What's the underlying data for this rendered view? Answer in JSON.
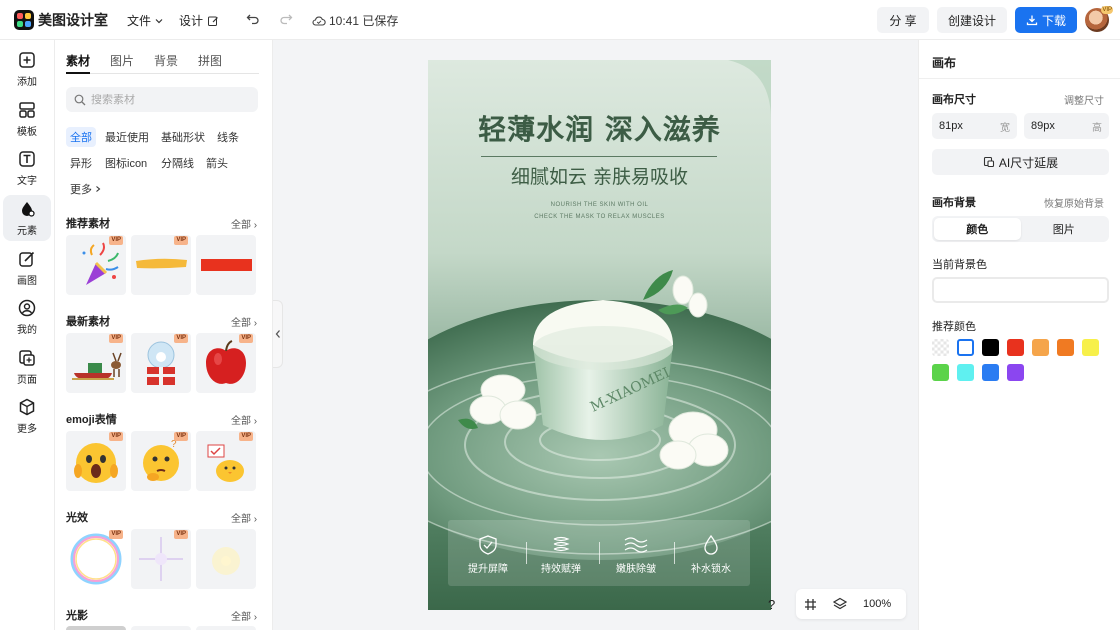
{
  "app": {
    "name": "美图设计室"
  },
  "topbar": {
    "file_menu": "文件",
    "design_menu": "设计",
    "save_status": "10:41 已保存",
    "share": "分 享",
    "create_design": "创建设计",
    "download": "下载",
    "avatar_badge": "VIP"
  },
  "rail": {
    "items": [
      {
        "label": "添加",
        "icon": "plus-square-icon"
      },
      {
        "label": "模板",
        "icon": "layout-icon"
      },
      {
        "label": "文字",
        "icon": "text-icon"
      },
      {
        "label": "元素",
        "icon": "shapes-icon"
      },
      {
        "label": "画图",
        "icon": "pen-icon"
      },
      {
        "label": "我的",
        "icon": "user-icon"
      },
      {
        "label": "页面",
        "icon": "page-add-icon"
      },
      {
        "label": "更多",
        "icon": "cube-icon"
      }
    ]
  },
  "panel": {
    "tabs": [
      "素材",
      "图片",
      "背景",
      "拼图"
    ],
    "search_placeholder": "搜索素材",
    "chips": [
      "全部",
      "最近使用",
      "基础形状",
      "线条",
      "异形",
      "图标icon",
      "分隔线",
      "箭头",
      "更多"
    ],
    "sections": [
      {
        "title": "推荐素材",
        "all": "全部"
      },
      {
        "title": "最新素材",
        "all": "全部"
      },
      {
        "title": "emoji表情",
        "all": "全部"
      },
      {
        "title": "光效",
        "all": "全部"
      },
      {
        "title": "光影",
        "all": "全部"
      }
    ],
    "vip_badge": "VIP"
  },
  "poster": {
    "headline": "轻薄水润 深入滋养",
    "subheadline": "细腻如云 亲肤易吸收",
    "english_line1": "NOURISH THE SKIN WITH OIL",
    "english_line2": "CHECK THE MASK TO RELAX MUSCLES",
    "jar_brand": "M-XIAOMEI",
    "features": [
      "提升屏障",
      "持效赋弹",
      "嫩肤除皱",
      "补水锁水"
    ]
  },
  "canvas_tools": {
    "help": "?",
    "zoom": "100%"
  },
  "right_panel": {
    "title": "画布",
    "size_label": "画布尺寸",
    "adjust_size": "调整尺寸",
    "width_value": "81px",
    "width_unit": "宽",
    "height_value": "89px",
    "height_unit": "高",
    "ai_extend": "AI尺寸延展",
    "bg_label": "画布背景",
    "restore_bg": "恢复原始背景",
    "seg_color": "颜色",
    "seg_image": "图片",
    "current_bg": "当前背景色",
    "recommended": "推荐颜色",
    "swatches": [
      "transparent",
      "#ffffff",
      "#000000",
      "#e8321e",
      "#f5a54b",
      "#f07a22",
      "#f7f04a",
      "#5bd34a",
      "#5ff0f0",
      "#2a7cf2",
      "#8b46f0"
    ]
  }
}
